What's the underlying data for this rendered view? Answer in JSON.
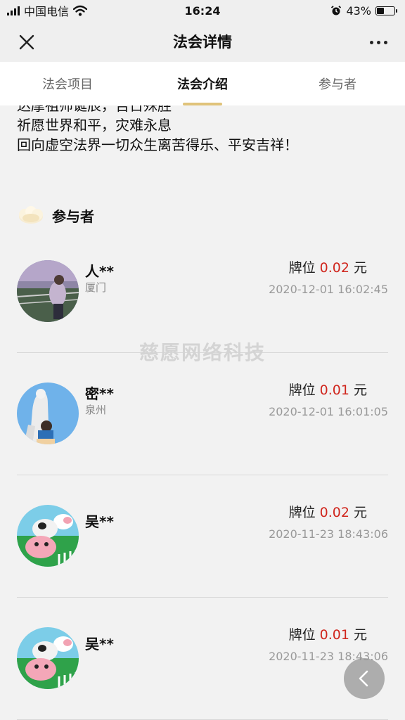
{
  "status_bar": {
    "carrier": "中国电信",
    "time": "16:24",
    "battery_percent": "43%",
    "battery_level": 0.43,
    "icons": [
      "signal-icon",
      "wifi-icon",
      "alarm-icon",
      "battery-icon"
    ]
  },
  "nav": {
    "title": "法会详情",
    "close_icon": "close-icon",
    "more_icon": "more-icon"
  },
  "tabs": [
    {
      "label": "法会项目",
      "active": false
    },
    {
      "label": "法会介绍",
      "active": true
    },
    {
      "label": "参与者",
      "active": false
    }
  ],
  "intro": {
    "lines": [
      "达摩祖师诞辰，吉日殊胜",
      "祈愿世界和平，灾难永息",
      "回向虚空法界一切众生离苦得乐、平安吉祥！"
    ]
  },
  "participants_section": {
    "title": "参与者",
    "icon": "lotus-icon"
  },
  "participants": [
    {
      "name": "人**",
      "city": "厦门",
      "price_label": "牌位",
      "amount": "0.02",
      "unit": "元",
      "time": "2020-12-01 16:02:45"
    },
    {
      "name": "密**",
      "city": "泉州",
      "price_label": "牌位",
      "amount": "0.01",
      "unit": "元",
      "time": "2020-12-01 16:01:05"
    },
    {
      "name": "吴**",
      "city": "",
      "price_label": "牌位",
      "amount": "0.02",
      "unit": "元",
      "time": "2020-11-23 18:43:06"
    },
    {
      "name": "吴**",
      "city": "",
      "price_label": "牌位",
      "amount": "0.01",
      "unit": "元",
      "time": "2020-11-23 18:43:06"
    }
  ],
  "watermark": "慈愿网络科技",
  "colors": {
    "accent": "#e0c37a",
    "amount": "#d0261d",
    "background": "#f2f2f2"
  }
}
